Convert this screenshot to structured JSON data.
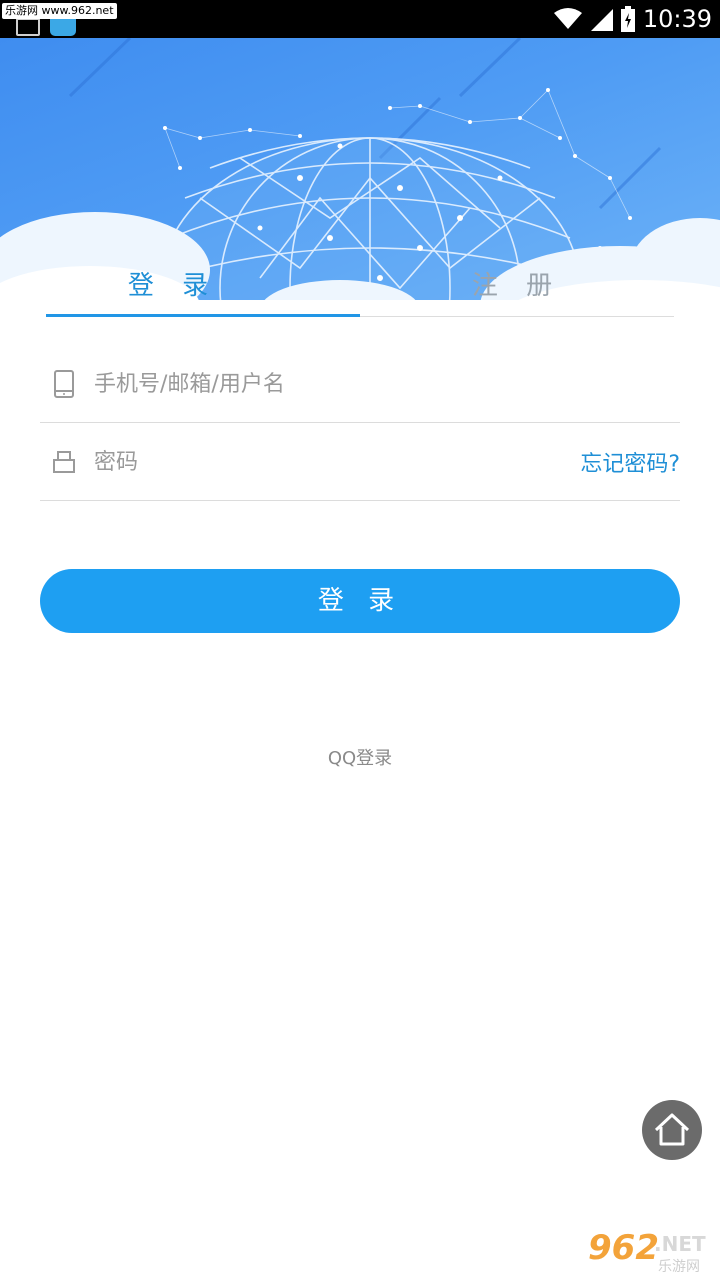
{
  "status_bar": {
    "site_label": "乐游网 www.962.net",
    "time": "10:39"
  },
  "tabs": [
    {
      "label": "登 录",
      "active": true
    },
    {
      "label": "注 册",
      "active": false
    }
  ],
  "form": {
    "username_placeholder": "手机号/邮箱/用户名",
    "password_placeholder": "密码",
    "forgot_label": "忘记密码?"
  },
  "login_button": "登 录",
  "qq_login": "QQ登录",
  "watermark": {
    "number": "962",
    "suffix": ".NET",
    "cn": "乐游网"
  },
  "colors": {
    "accent": "#1e9ff2",
    "tab_active": "#1f8fd6",
    "header_blue": "#4a95f2"
  }
}
